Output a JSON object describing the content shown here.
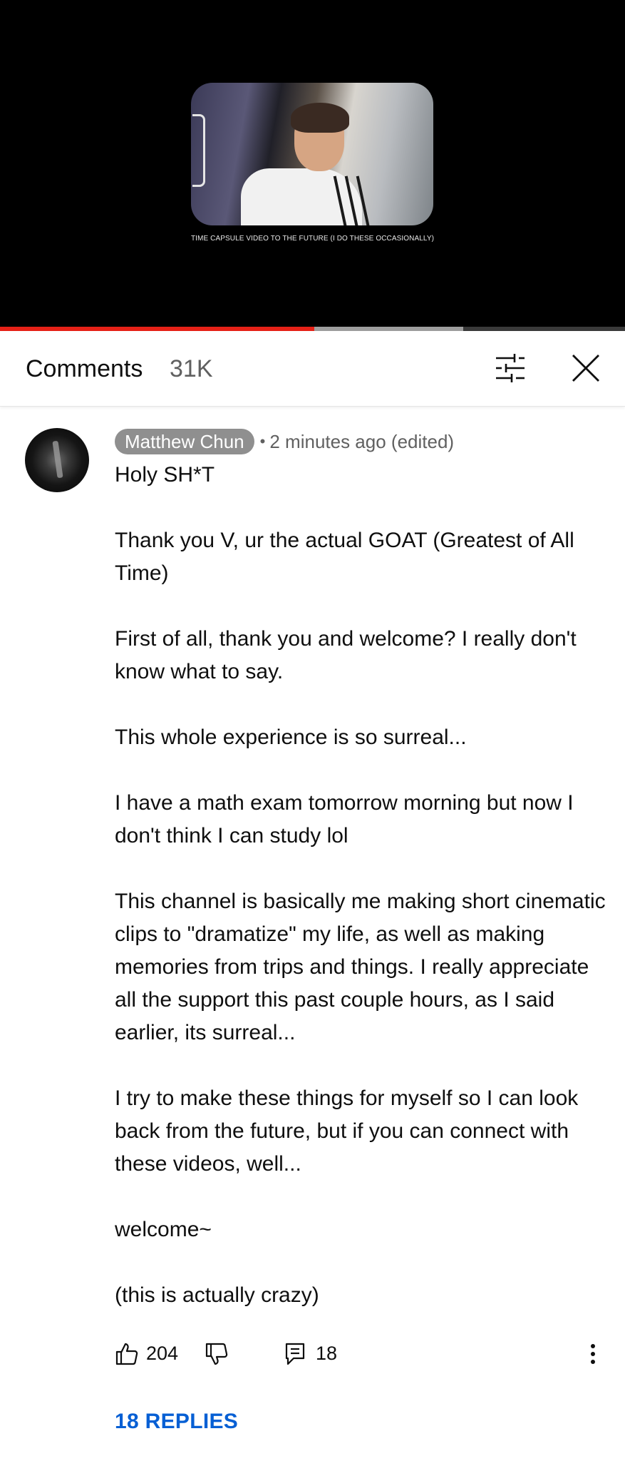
{
  "video": {
    "caption": "TIME CAPSULE VIDEO TO THE FUTURE (I DO THESE OCCASIONALLY)",
    "progress_played_percent": 50.3,
    "progress_buffered_percent": 74.1,
    "progress_color": "#e62117"
  },
  "comments_header": {
    "title": "Comments",
    "count": "31K",
    "filter_icon": "filter-sliders-icon",
    "close_icon": "close-icon"
  },
  "comment": {
    "author": "Matthew Chun",
    "separator": "•",
    "time": "2 minutes ago (edited)",
    "paragraphs": [
      "Holy SH*T",
      "Thank you V, ur the actual GOAT (Greatest of All Time)",
      "First of all, thank you and welcome? I really don't know what to say.",
      "This whole experience is so surreal...",
      "I have a math exam tomorrow morning but now I don't think I can study lol",
      "This channel is basically me making short cinematic clips to \"dramatize\" my life, as well as making memories from trips and things. I really appreciate all the support this past couple hours, as I said earlier, its surreal...",
      "I try to make these things for myself so I can look back from the future, but if you can connect with these videos, well...",
      "welcome~",
      "(this is actually crazy)"
    ],
    "likes": "204",
    "replies": "18",
    "replies_link": "18 REPLIES"
  },
  "colors": {
    "link_blue": "#065fd4",
    "author_chip": "#8f8f8f",
    "secondary_text": "#606060"
  }
}
